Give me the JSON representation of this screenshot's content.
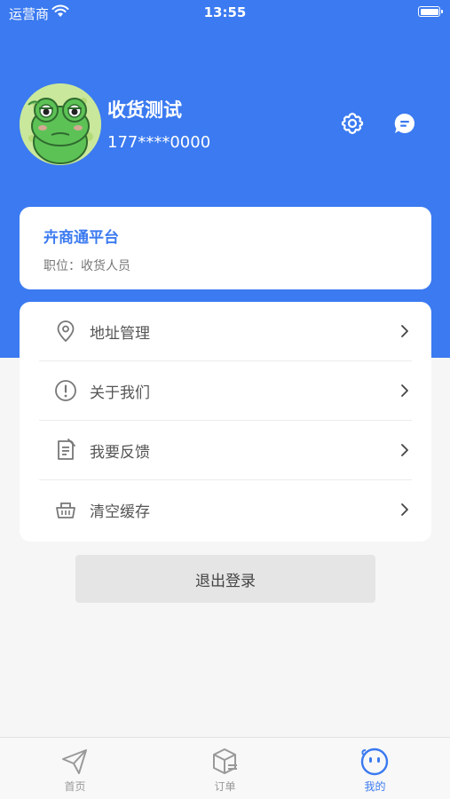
{
  "status_bar": {
    "carrier": "运营商",
    "time": "13:55"
  },
  "profile": {
    "name": "收货测试",
    "phone": "177****0000",
    "avatar_icon": "frog-avatar"
  },
  "header_actions": {
    "settings_icon": "gear-icon",
    "message_icon": "chat-icon"
  },
  "company": {
    "name": "卉商通平台",
    "position": "职位：收货人员"
  },
  "menu": {
    "items": [
      {
        "label": "地址管理",
        "icon": "location-pin-icon"
      },
      {
        "label": "关于我们",
        "icon": "info-circle-icon"
      },
      {
        "label": "我要反馈",
        "icon": "feedback-note-icon"
      },
      {
        "label": "清空缓存",
        "icon": "basket-icon"
      }
    ]
  },
  "logout": {
    "label": "退出登录"
  },
  "tab_bar": {
    "tabs": [
      {
        "label": "首页",
        "icon": "paper-plane-icon",
        "active": false
      },
      {
        "label": "订单",
        "icon": "box-icon",
        "active": false
      },
      {
        "label": "我的",
        "icon": "smiley-face-icon",
        "active": true
      }
    ]
  },
  "colors": {
    "primary": "#3b7af0",
    "background": "#f6f6f6",
    "card": "#ffffff",
    "logout_bg": "#e5e5e5"
  }
}
